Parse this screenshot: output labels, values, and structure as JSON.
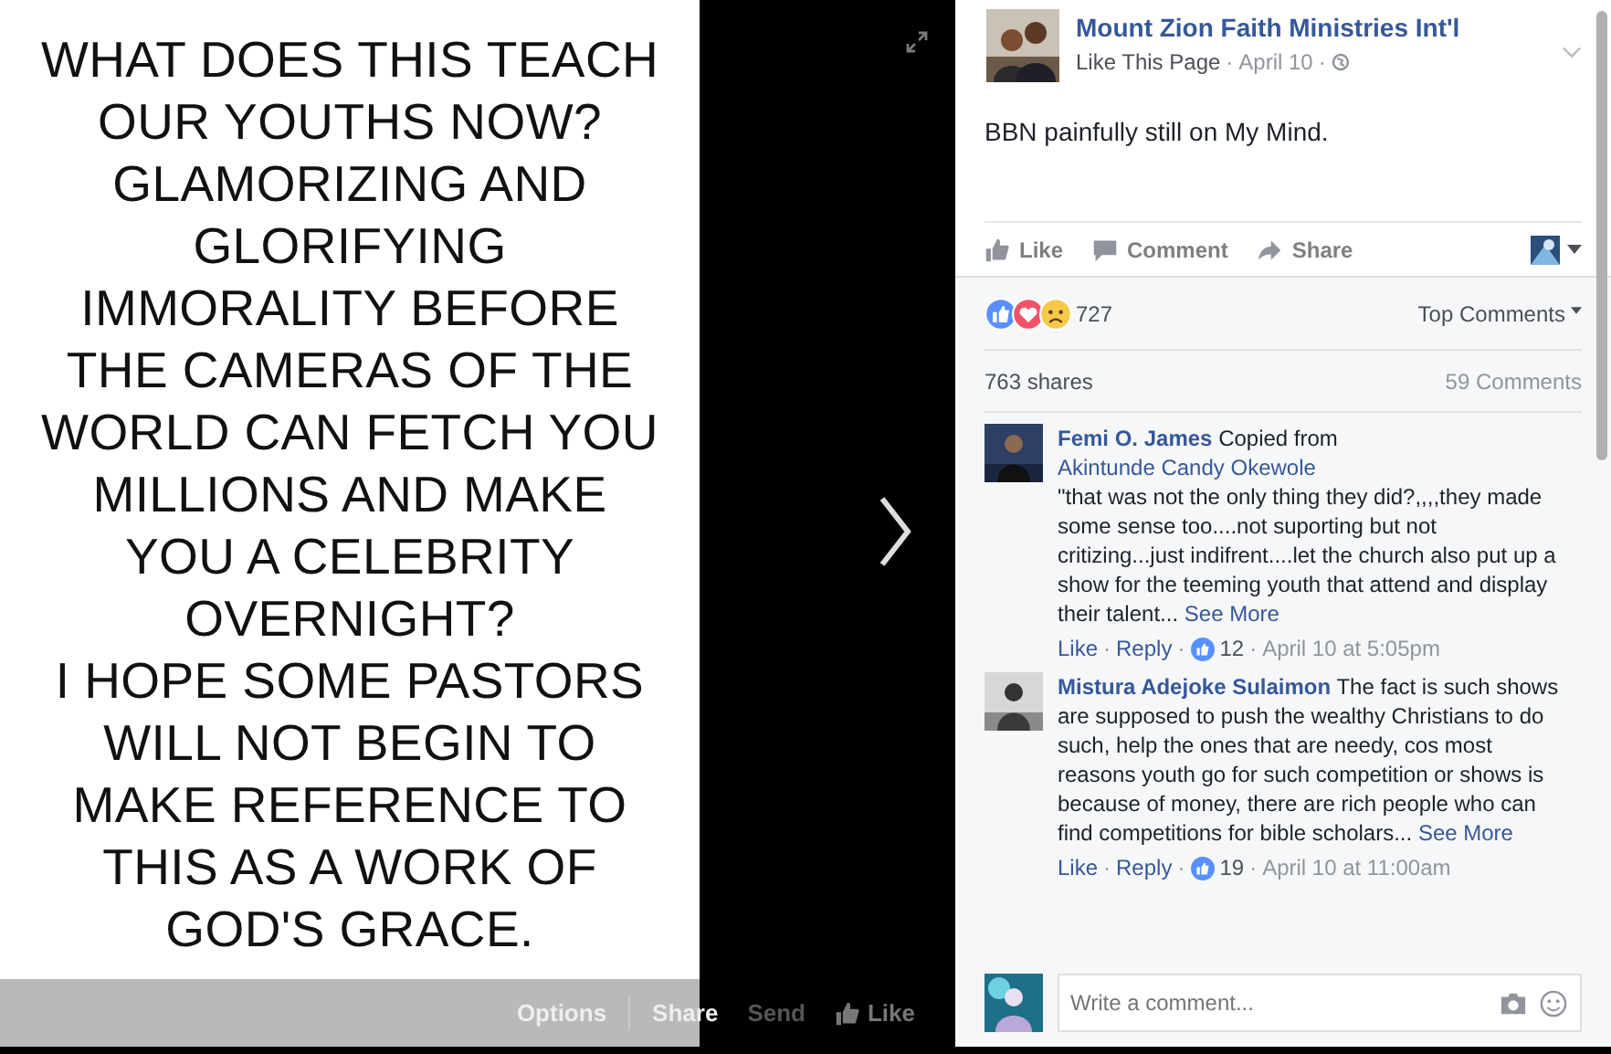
{
  "photo": {
    "lines": [
      "WHAT DOES THIS TEACH",
      "OUR YOUTHS NOW?",
      "GLAMORIZING AND",
      "GLORIFYING",
      "IMMORALITY BEFORE",
      "THE CAMERAS OF THE",
      "WORLD CAN FETCH YOU",
      "MILLIONS AND MAKE",
      "YOU A CELEBRITY",
      "OVERNIGHT?",
      "I HOPE SOME PASTORS",
      "WILL NOT BEGIN TO",
      "MAKE REFERENCE TO",
      "THIS AS A WORK OF",
      "GOD'S GRACE."
    ]
  },
  "photo_bar": [
    {
      "label": "Options",
      "kind": "options"
    },
    {
      "label": "Share",
      "kind": "share"
    },
    {
      "label": "Send",
      "kind": "send"
    },
    {
      "label": "Like",
      "kind": "like"
    }
  ],
  "post": {
    "author": "Mount Zion Faith Ministries Int'l",
    "like_page": "Like This Page",
    "separators": [
      "·",
      "·"
    ],
    "date": "April 10",
    "text": "BBN painfully still on My Mind.",
    "actions": [
      {
        "label": "Like",
        "kind": "like"
      },
      {
        "label": "Comment",
        "kind": "comment"
      },
      {
        "label": "Share",
        "kind": "share"
      }
    ]
  },
  "reactions": {
    "count": "727",
    "sort": "Top Comments"
  },
  "stats": {
    "shares": "763 shares",
    "comments": "59 Comments"
  },
  "comments": [
    {
      "author": "Femi O. James",
      "attribution": {
        "prefix": "Copied from",
        "link": "Akintunde Candy Okewole"
      },
      "body": "\"that was not the only thing they did?,,,,they made some sense too....not suporting but not critizing...just indifrent....let the church also put up a show for the teeming youth that attend and display their talent...",
      "see_more": "See More",
      "like": "Like",
      "reply": "Reply",
      "separators": [
        "·",
        "·",
        "·"
      ],
      "likes": "12",
      "time": "April 10 at 5:05pm"
    },
    {
      "author": "Mistura Adejoke Sulaimon",
      "body": "The fact is such shows are supposed to push the wealthy Christians to do such, help the ones that are needy, cos most reasons youth go for such competition or shows is because of money, there are rich people who can find competitions for bible scholars...",
      "see_more": "See More",
      "like": "Like",
      "reply": "Reply",
      "separators": [
        "·",
        "·",
        "·"
      ],
      "likes": "19",
      "time": "April 10 at 11:00am"
    }
  ],
  "composer": {
    "placeholder": "Write a comment..."
  }
}
